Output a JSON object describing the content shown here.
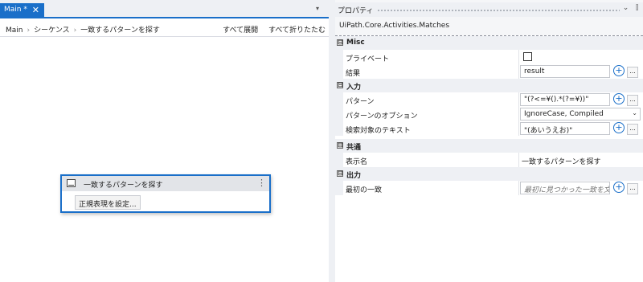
{
  "tab": {
    "label": "Main *",
    "close": "✕"
  },
  "breadcrumb": {
    "items": [
      "Main",
      "シーケンス",
      "一致するパターンを探す"
    ],
    "separator": "›"
  },
  "designer_actions": {
    "expand_all": "すべて展開",
    "collapse_all": "すべて折りたたむ"
  },
  "activity": {
    "title": "一致するパターンを探す",
    "regex_button": "正規表現を設定..."
  },
  "properties": {
    "title": "プロパティ",
    "type_name": "UiPath.Core.Activities.Matches",
    "categories": [
      {
        "label": "Misc"
      },
      {
        "label": "入力"
      },
      {
        "label": "共通"
      },
      {
        "label": "出力"
      }
    ],
    "rows": {
      "private": {
        "name": "プライベート",
        "checked": false
      },
      "result": {
        "name": "結果",
        "value": "result"
      },
      "pattern": {
        "name": "パターン",
        "value": "\"(?<=¥().*(?=¥))\""
      },
      "pattern_options": {
        "name": "パターンのオプション",
        "value": "IgnoreCase, Compiled"
      },
      "input": {
        "name": "検索対象のテキスト",
        "value": "\"(あいうえお)\""
      },
      "display_name": {
        "name": "表示名",
        "value": "一致するパターンを探す"
      },
      "first_match": {
        "name": "最初の一致",
        "placeholder": "最初に見つかった一致を文字"
      }
    },
    "collapse_glyph": "⊟"
  },
  "icons": {
    "plus": "+",
    "ellipsis": "...",
    "dropdown": "⌄",
    "pin": "⫿",
    "chevron": "▾",
    "more": "⋮"
  },
  "colors": {
    "accent": "#1a6fc9"
  }
}
